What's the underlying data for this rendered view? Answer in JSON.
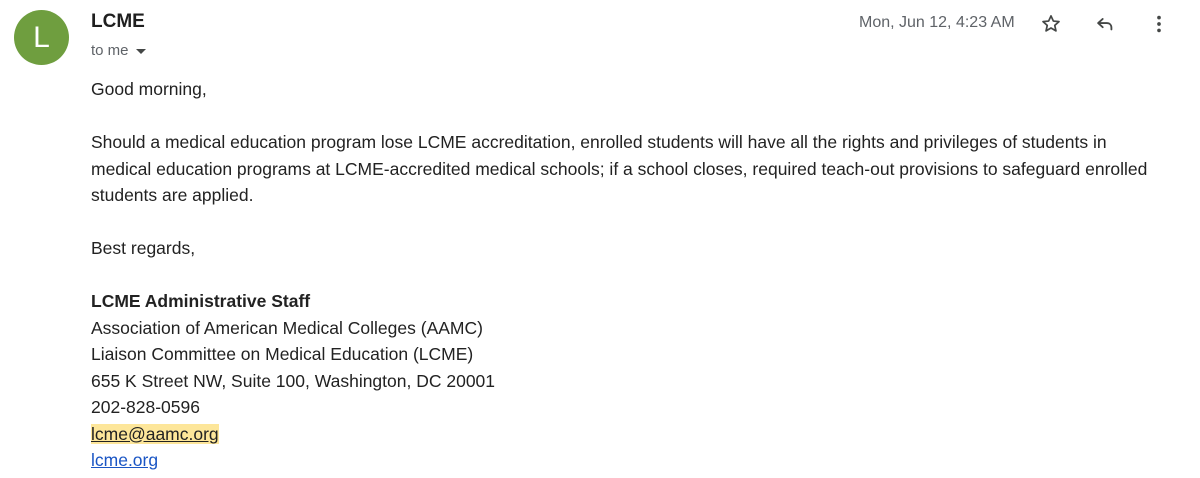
{
  "avatar": {
    "letter": "L",
    "color": "#6f9e3f"
  },
  "header": {
    "sender": "LCME",
    "recipient": "to me",
    "date": "Mon, Jun 12, 4:23 AM"
  },
  "icons": {
    "star": "star-outline-icon",
    "reply": "reply-icon",
    "more": "more-vert-icon"
  },
  "message": {
    "greeting": "Good morning,",
    "paragraph": "Should a medical education program lose LCME accreditation, enrolled students will have all the rights and privileges of students in medical education programs at LCME-accredited medical schools; if a school closes, required teach-out provisions to safeguard enrolled students are applied.",
    "closing": "Best regards,"
  },
  "signature": {
    "name": "LCME Administrative Staff",
    "org": "Association of American Medical Colleges (AAMC)",
    "committee": "Liaison Committee on Medical Education (LCME)",
    "address": "655 K Street NW, Suite 100, Washington, DC 20001",
    "phone": "202-828-0596",
    "email": "lcme@aamc.org",
    "website": "lcme.org"
  },
  "colors": {
    "link": "#1a55c4",
    "email_highlight": "#fde69a"
  }
}
